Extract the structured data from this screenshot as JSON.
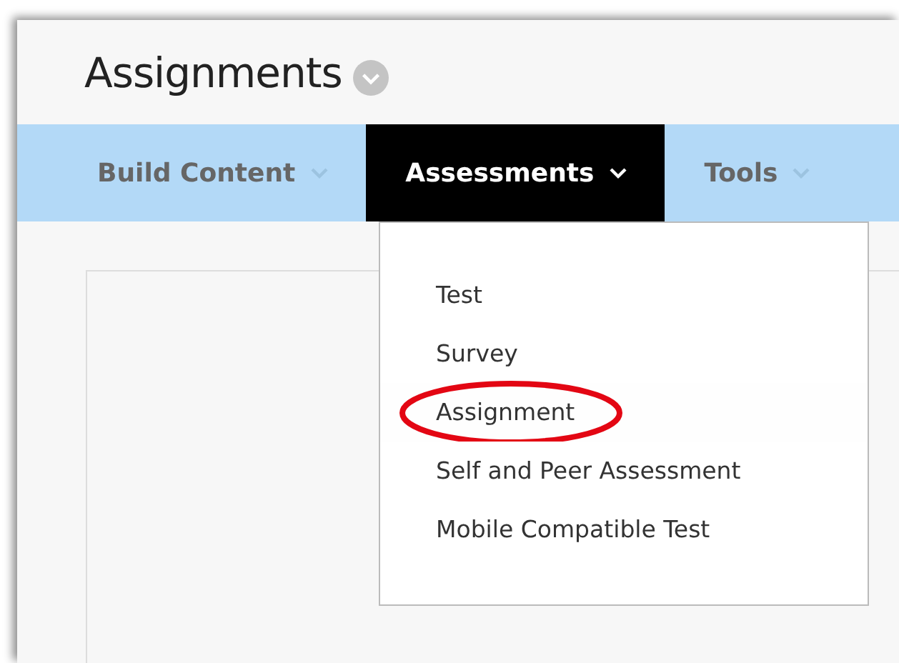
{
  "page": {
    "title": "Assignments"
  },
  "tabs": [
    {
      "label": "Build Content",
      "selected": false
    },
    {
      "label": "Assessments",
      "selected": true
    },
    {
      "label": "Tools",
      "selected": false
    }
  ],
  "menu": {
    "items": [
      {
        "label": "Test",
        "highlighted": false
      },
      {
        "label": "Survey",
        "highlighted": false
      },
      {
        "label": "Assignment",
        "highlighted": true
      },
      {
        "label": "Self and Peer Assessment",
        "highlighted": false
      },
      {
        "label": "Mobile Compatible Test",
        "highlighted": false
      }
    ]
  }
}
